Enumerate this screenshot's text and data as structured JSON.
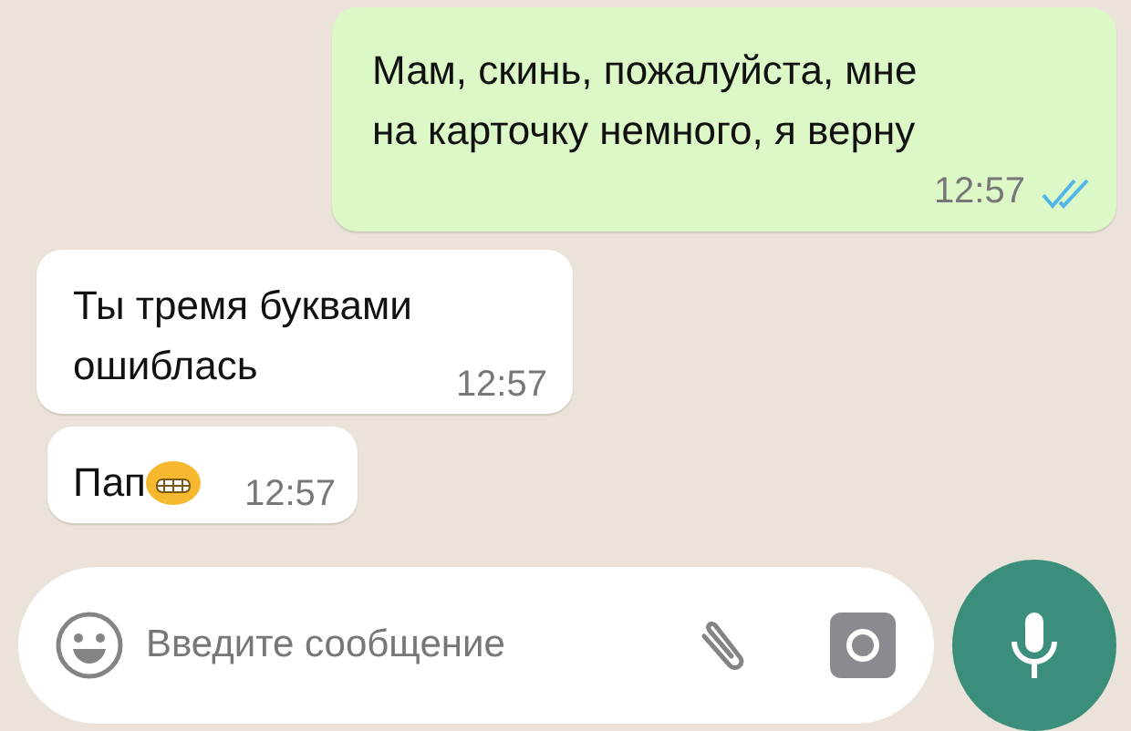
{
  "messages": [
    {
      "kind": "outgoing",
      "lines": [
        "Мам, скинь, пожалуйста, мне",
        "на карточку немного, я верну"
      ],
      "time": "12:57",
      "read": true,
      "emoji": false
    },
    {
      "kind": "incoming",
      "lines": [
        "Ты тремя буквами",
        "ошиблась"
      ],
      "time": "12:57",
      "emoji": false
    },
    {
      "kind": "incoming",
      "lines": [
        "Пап"
      ],
      "time": "12:57",
      "emoji": true
    }
  ],
  "composer": {
    "placeholder": "Введите сообщение"
  }
}
